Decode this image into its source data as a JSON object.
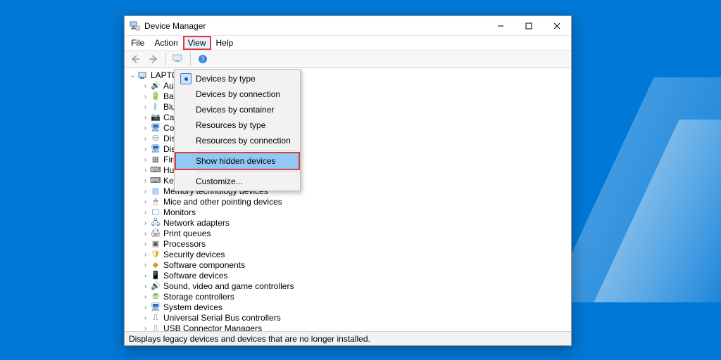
{
  "window": {
    "title": "Device Manager"
  },
  "menubar": {
    "items": [
      "File",
      "Action",
      "View",
      "Help"
    ],
    "highlighted_index": 2
  },
  "dropdown": {
    "items": [
      {
        "label": "Devices by type",
        "checked": true
      },
      {
        "label": "Devices by connection",
        "checked": false
      },
      {
        "label": "Devices by container",
        "checked": false
      },
      {
        "label": "Resources by type",
        "checked": false
      },
      {
        "label": "Resources by connection",
        "checked": false
      }
    ],
    "hidden_item": {
      "label": "Show hidden devices",
      "selected": true
    },
    "customize_label": "Customize...",
    "highlighted_item_index": 5
  },
  "tree": {
    "root": "LAPTOP",
    "children": [
      {
        "label": "Audio inputs and outputs",
        "icon_name": "audio-icon",
        "glyph": "🔊",
        "color": "#4a90e2"
      },
      {
        "label": "Batteries",
        "icon_name": "battery-icon",
        "glyph": "🔋",
        "color": "#3aa23a"
      },
      {
        "label": "Bluetooth",
        "icon_name": "bluetooth-icon",
        "glyph": "ᛒ",
        "color": "#1e62d0"
      },
      {
        "label": "Cameras",
        "icon_name": "camera-icon",
        "glyph": "📷",
        "color": "#555"
      },
      {
        "label": "Computer",
        "icon_name": "computer-icon",
        "glyph": "🖥",
        "color": "#2c6fbb"
      },
      {
        "label": "Disk drives",
        "icon_name": "disk-icon",
        "glyph": "⛁",
        "color": "#888"
      },
      {
        "label": "Display adapters",
        "icon_name": "display-icon",
        "glyph": "🖥",
        "color": "#2c6fbb"
      },
      {
        "label": "Firmware",
        "icon_name": "firmware-icon",
        "glyph": "▦",
        "color": "#666"
      },
      {
        "label": "Human Interface Devices",
        "icon_name": "hid-icon",
        "glyph": "⌨",
        "color": "#444"
      },
      {
        "label": "Keyboards",
        "icon_name": "keyboard-icon",
        "glyph": "⌨",
        "color": "#444"
      },
      {
        "label": "Memory technology devices",
        "icon_name": "memory-icon",
        "glyph": "▤",
        "color": "#4a90e2"
      },
      {
        "label": "Mice and other pointing devices",
        "icon_name": "mouse-icon",
        "glyph": "🖱",
        "color": "#555"
      },
      {
        "label": "Monitors",
        "icon_name": "monitor-icon",
        "glyph": "🖵",
        "color": "#2c6fbb"
      },
      {
        "label": "Network adapters",
        "icon_name": "network-icon",
        "glyph": "🖧",
        "color": "#2c6fbb"
      },
      {
        "label": "Print queues",
        "icon_name": "printer-icon",
        "glyph": "🖨",
        "color": "#555"
      },
      {
        "label": "Processors",
        "icon_name": "cpu-icon",
        "glyph": "▣",
        "color": "#555"
      },
      {
        "label": "Security devices",
        "icon_name": "security-icon",
        "glyph": "🛡",
        "color": "#d4a017"
      },
      {
        "label": "Software components",
        "icon_name": "software-comp-icon",
        "glyph": "◆",
        "color": "#d4a017"
      },
      {
        "label": "Software devices",
        "icon_name": "software-dev-icon",
        "glyph": "📱",
        "color": "#555"
      },
      {
        "label": "Sound, video and game controllers",
        "icon_name": "sound-icon",
        "glyph": "🔊",
        "color": "#4a90e2"
      },
      {
        "label": "Storage controllers",
        "icon_name": "storage-icon",
        "glyph": "⛃",
        "color": "#6aa84f"
      },
      {
        "label": "System devices",
        "icon_name": "system-icon",
        "glyph": "🖥",
        "color": "#2c6fbb"
      },
      {
        "label": "Universal Serial Bus controllers",
        "icon_name": "usb-icon",
        "glyph": "⎍",
        "color": "#555"
      },
      {
        "label": "USB Connector Managers",
        "icon_name": "usb-connector-icon",
        "glyph": "⎍",
        "color": "#555"
      }
    ]
  },
  "statusbar": {
    "text": "Displays legacy devices and devices that are no longer installed."
  },
  "colors": {
    "highlight_red": "#e03a3a",
    "menu_selection_blue": "#90c8f6"
  }
}
